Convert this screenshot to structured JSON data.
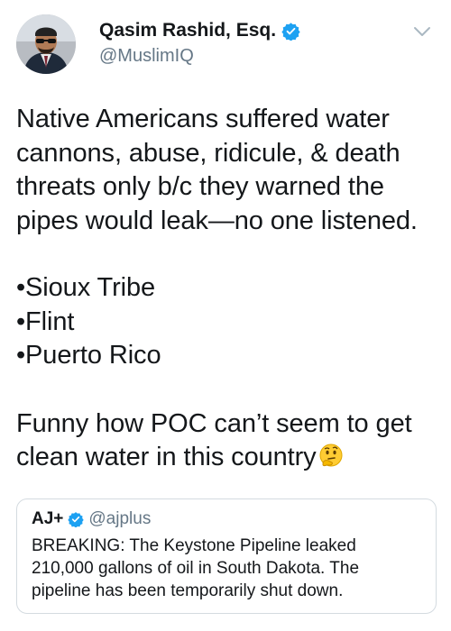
{
  "tweet": {
    "author": {
      "display_name": "Qasim Rashid, Esq.",
      "handle": "@MuslimIQ",
      "verified": true
    },
    "menu_icon": "chevron-down-icon",
    "text": {
      "line1": "Native Americans suffered water cannons, abuse, ridicule, & death threats only b/c they warned the pipes would leak—no one listened.",
      "bullets": [
        "•Sioux Tribe",
        "•Flint",
        "•Puerto Rico"
      ],
      "closing": "Funny how POC can’t seem to get clean water in this country",
      "emoji": "thinking-face-emoji"
    }
  },
  "quoted_tweet": {
    "display_name": "AJ+",
    "handle": "@ajplus",
    "verified": true,
    "text": "BREAKING: The Keystone Pipeline leaked 210,000 gallons of oil in South Dakota. The pipeline has been temporarily shut down."
  },
  "colors": {
    "verified_blue": "#1da1f2",
    "secondary_text": "#657786",
    "border": "#d4dbe0"
  }
}
